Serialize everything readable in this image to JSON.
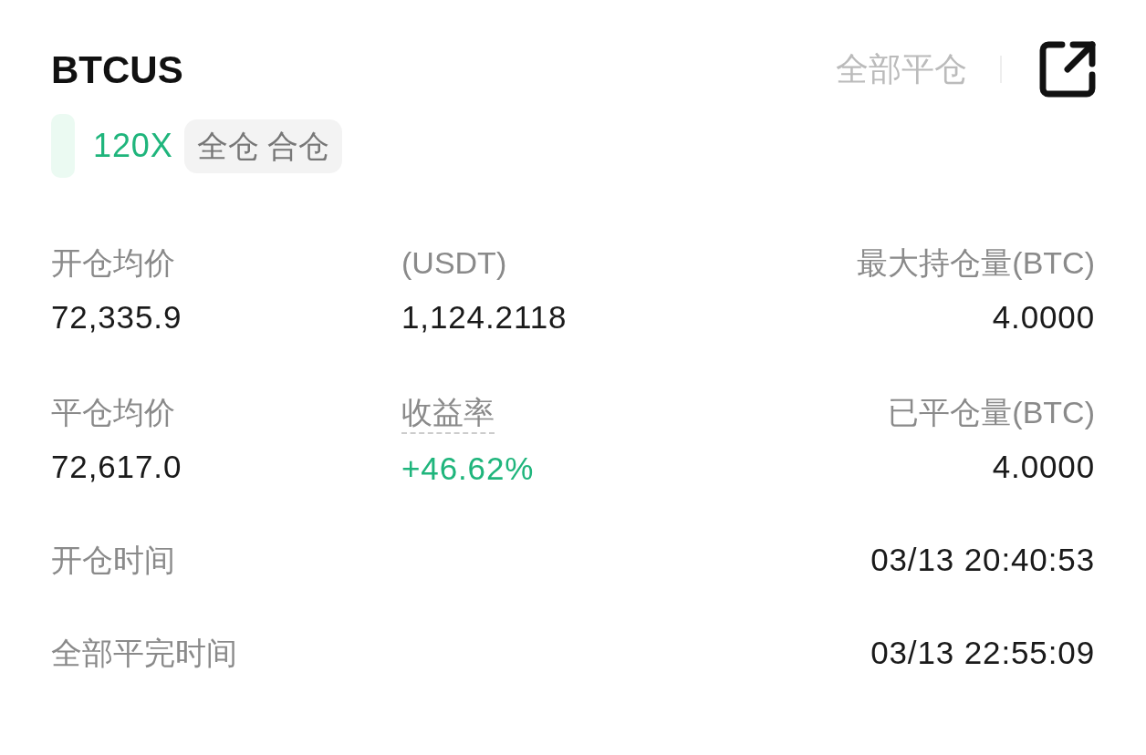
{
  "header": {
    "symbol": "BTCUS",
    "close_all": "全部平仓"
  },
  "tags": {
    "leverage": "120X",
    "mode": "全仓 合仓"
  },
  "stats": [
    {
      "label": "开仓均价",
      "value": "72,335.9",
      "positive": false,
      "dashed": false
    },
    {
      "label": "(USDT)",
      "value": "1,124.2118",
      "positive": false,
      "dashed": false
    },
    {
      "label": "最大持仓量(BTC)",
      "value": "4.0000",
      "positive": false,
      "dashed": false
    },
    {
      "label": "平仓均价",
      "value": "72,617.0",
      "positive": false,
      "dashed": false
    },
    {
      "label": "收益率",
      "value": "+46.62%",
      "positive": true,
      "dashed": true
    },
    {
      "label": "已平仓量(BTC)",
      "value": "4.0000",
      "positive": false,
      "dashed": false
    }
  ],
  "times": [
    {
      "label": "开仓时间",
      "value": "03/13 20:40:53"
    },
    {
      "label": "全部平完时间",
      "value": "03/13 22:55:09"
    }
  ]
}
